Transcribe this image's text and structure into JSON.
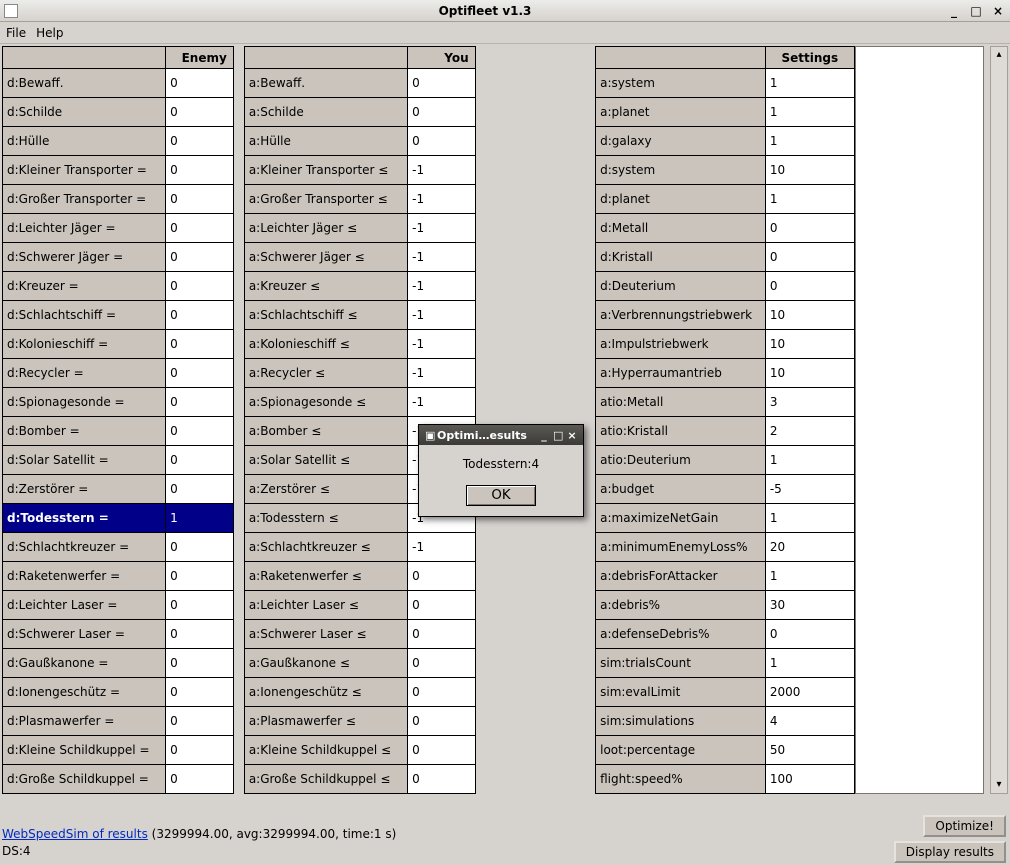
{
  "window": {
    "title": "Optifleet v1.3",
    "menu": {
      "file": "File",
      "help": "Help"
    }
  },
  "headers": {
    "enemy": "Enemy",
    "you": "You",
    "settings": "Settings"
  },
  "enemy": [
    {
      "label": "d:Bewaff.",
      "value": "0"
    },
    {
      "label": "d:Schilde",
      "value": "0"
    },
    {
      "label": "d:Hülle",
      "value": "0"
    },
    {
      "label": "d:Kleiner Transporter =",
      "value": "0"
    },
    {
      "label": "d:Großer Transporter =",
      "value": "0"
    },
    {
      "label": "d:Leichter Jäger =",
      "value": "0"
    },
    {
      "label": "d:Schwerer Jäger =",
      "value": "0"
    },
    {
      "label": "d:Kreuzer =",
      "value": "0"
    },
    {
      "label": "d:Schlachtschiff =",
      "value": "0"
    },
    {
      "label": "d:Kolonieschiff =",
      "value": "0"
    },
    {
      "label": "d:Recycler =",
      "value": "0"
    },
    {
      "label": "d:Spionagesonde =",
      "value": "0"
    },
    {
      "label": "d:Bomber =",
      "value": "0"
    },
    {
      "label": "d:Solar Satellit =",
      "value": "0"
    },
    {
      "label": "d:Zerstörer =",
      "value": "0"
    },
    {
      "label": "d:Todesstern =",
      "value": "1",
      "selected": true
    },
    {
      "label": "d:Schlachtkreuzer =",
      "value": "0"
    },
    {
      "label": "d:Raketenwerfer =",
      "value": "0"
    },
    {
      "label": "d:Leichter Laser =",
      "value": "0"
    },
    {
      "label": "d:Schwerer Laser =",
      "value": "0"
    },
    {
      "label": "d:Gaußkanone =",
      "value": "0"
    },
    {
      "label": "d:Ionengeschütz =",
      "value": "0"
    },
    {
      "label": "d:Plasmawerfer =",
      "value": "0"
    },
    {
      "label": "d:Kleine Schildkuppel =",
      "value": "0"
    },
    {
      "label": "d:Große Schildkuppel =",
      "value": "0"
    }
  ],
  "you": [
    {
      "label": "a:Bewaff.",
      "value": "0"
    },
    {
      "label": "a:Schilde",
      "value": "0"
    },
    {
      "label": "a:Hülle",
      "value": "0"
    },
    {
      "label": "a:Kleiner Transporter ≤",
      "value": "-1"
    },
    {
      "label": "a:Großer Transporter ≤",
      "value": "-1"
    },
    {
      "label": "a:Leichter Jäger ≤",
      "value": "-1"
    },
    {
      "label": "a:Schwerer Jäger ≤",
      "value": "-1"
    },
    {
      "label": "a:Kreuzer ≤",
      "value": "-1"
    },
    {
      "label": "a:Schlachtschiff ≤",
      "value": "-1"
    },
    {
      "label": "a:Kolonieschiff ≤",
      "value": "-1"
    },
    {
      "label": "a:Recycler ≤",
      "value": "-1"
    },
    {
      "label": "a:Spionagesonde ≤",
      "value": "-1"
    },
    {
      "label": "a:Bomber ≤",
      "value": "-1"
    },
    {
      "label": "a:Solar Satellit ≤",
      "value": "-1"
    },
    {
      "label": "a:Zerstörer ≤",
      "value": "-1"
    },
    {
      "label": "a:Todesstern ≤",
      "value": "-1"
    },
    {
      "label": "a:Schlachtkreuzer ≤",
      "value": "-1"
    },
    {
      "label": "a:Raketenwerfer ≤",
      "value": "0"
    },
    {
      "label": "a:Leichter Laser ≤",
      "value": "0"
    },
    {
      "label": "a:Schwerer Laser ≤",
      "value": "0"
    },
    {
      "label": "a:Gaußkanone ≤",
      "value": "0"
    },
    {
      "label": "a:Ionengeschütz ≤",
      "value": "0"
    },
    {
      "label": "a:Plasmawerfer ≤",
      "value": "0"
    },
    {
      "label": "a:Kleine Schildkuppel ≤",
      "value": "0"
    },
    {
      "label": "a:Große Schildkuppel ≤",
      "value": "0"
    }
  ],
  "settings": [
    {
      "label": "a:system",
      "value": "1"
    },
    {
      "label": "a:planet",
      "value": "1"
    },
    {
      "label": "d:galaxy",
      "value": "1"
    },
    {
      "label": "d:system",
      "value": "10"
    },
    {
      "label": "d:planet",
      "value": "1"
    },
    {
      "label": "d:Metall",
      "value": "0"
    },
    {
      "label": "d:Kristall",
      "value": "0"
    },
    {
      "label": "d:Deuterium",
      "value": "0"
    },
    {
      "label": "a:Verbrennungstriebwerk",
      "value": "10"
    },
    {
      "label": "a:Impulstriebwerk",
      "value": "10"
    },
    {
      "label": "a:Hyperraumantrieb",
      "value": "10"
    },
    {
      "label": "atio:Metall",
      "value": "3"
    },
    {
      "label": "atio:Kristall",
      "value": "2"
    },
    {
      "label": "atio:Deuterium",
      "value": "1"
    },
    {
      "label": "a:budget",
      "value": "-5"
    },
    {
      "label": "a:maximizeNetGain",
      "value": "1"
    },
    {
      "label": "a:minimumEnemyLoss%",
      "value": "20"
    },
    {
      "label": "a:debrisForAttacker",
      "value": "1"
    },
    {
      "label": "a:debris%",
      "value": "30"
    },
    {
      "label": "a:defenseDebris%",
      "value": "0"
    },
    {
      "label": "sim:trialsCount",
      "value": "1"
    },
    {
      "label": "sim:evalLimit",
      "value": "2000"
    },
    {
      "label": "sim:simulations",
      "value": "4"
    },
    {
      "label": "loot:percentage",
      "value": "50"
    },
    {
      "label": "flight:speed%",
      "value": "100"
    }
  ],
  "dialog": {
    "title": "Optimi…esults",
    "message": "Todesstern:4",
    "ok": "OK"
  },
  "footer": {
    "linktext": "WebSpeedSim of results",
    "stats": " (3299994.00, avg:3299994.00, time:1 s)",
    "ds": "DS:4"
  },
  "buttons": {
    "optimize": "Optimize!",
    "display": "Display results"
  }
}
